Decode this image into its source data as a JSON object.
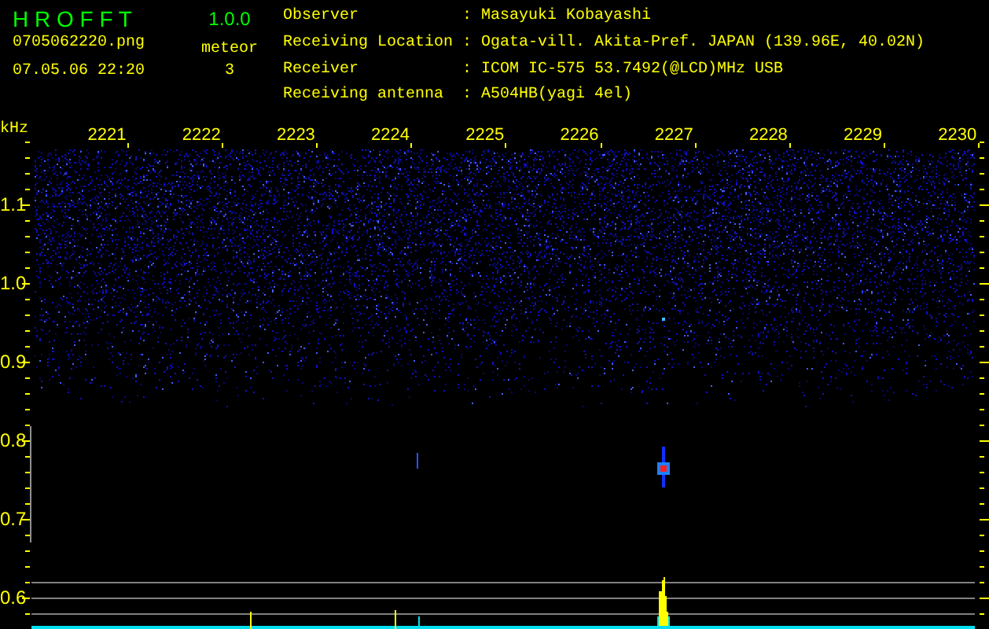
{
  "app": {
    "title": "H R O F F T",
    "version": "1.0.0"
  },
  "file": {
    "name": "0705062220.png",
    "datetime": "07.05.06 22:20"
  },
  "meteor": {
    "label": "meteor",
    "count": "3"
  },
  "station": [
    {
      "label": "Observer",
      "separator": ":",
      "value": "Masayuki Kobayashi"
    },
    {
      "label": "Receiving Location",
      "separator": ":",
      "value": "Ogata-vill. Akita-Pref. JAPAN (139.96E, 40.02N)"
    },
    {
      "label": "Receiver",
      "separator": ":",
      "value": "ICOM IC-575 53.7492(@LCD)MHz USB"
    },
    {
      "label": "Receiving antenna",
      "separator": ":",
      "value": "A504HB(yagi 4el)"
    }
  ],
  "spectrogram": {
    "y_unit": "kHz",
    "x_labels": [
      "2221",
      "2222",
      "2223",
      "2224",
      "2225",
      "2226",
      "2227",
      "2228",
      "2229",
      "2230"
    ],
    "y_labels": [
      "1.1",
      "1.0",
      "0.9",
      "0.8",
      "0.7",
      "0.6"
    ]
  }
}
